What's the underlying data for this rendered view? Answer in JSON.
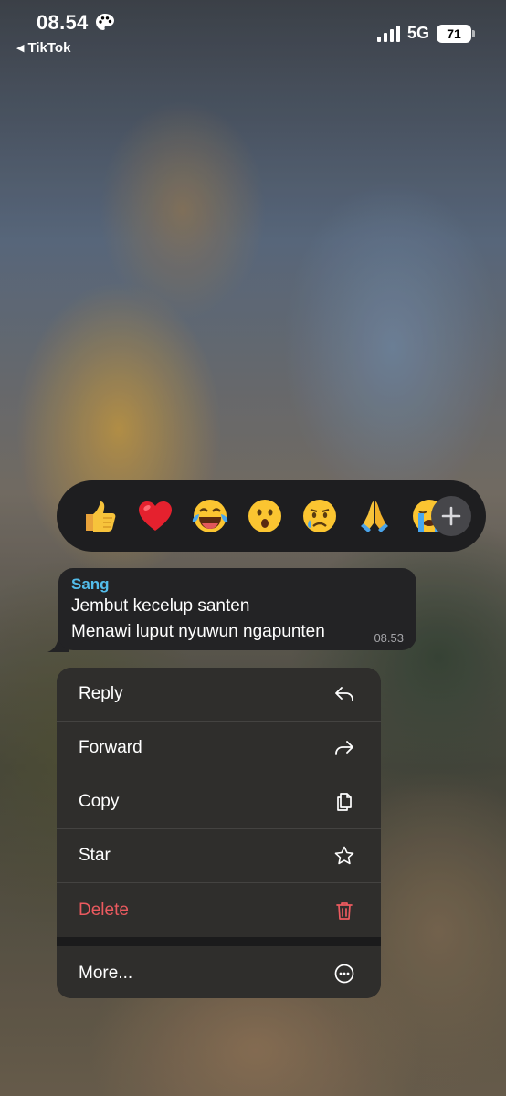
{
  "status_bar": {
    "time": "08.54",
    "back_app": "TikTok",
    "network": "5G",
    "battery": "71"
  },
  "reactions": {
    "emojis": [
      "👍",
      "❤️",
      "😂",
      "😮",
      "😢",
      "🙏",
      "😭"
    ],
    "more": "+"
  },
  "message": {
    "sender": "Sang",
    "lines": [
      "Jembut kecelup santen",
      "Menawi luput nyuwun ngapunten"
    ],
    "time": "08.53"
  },
  "menu": {
    "items": [
      {
        "label": "Reply",
        "icon": "reply-icon"
      },
      {
        "label": "Forward",
        "icon": "forward-icon"
      },
      {
        "label": "Copy",
        "icon": "copy-icon"
      },
      {
        "label": "Star",
        "icon": "star-icon"
      },
      {
        "label": "Delete",
        "icon": "trash-icon",
        "color": "#eb5a5f"
      }
    ],
    "more": {
      "label": "More...",
      "icon": "ellipsis-circle-icon"
    }
  },
  "colors": {
    "sender": "#53bdeb",
    "danger": "#eb5a5f",
    "bubble": "#232325",
    "reaction_bar": "#1e1e20"
  }
}
